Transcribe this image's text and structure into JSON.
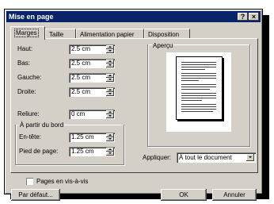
{
  "window": {
    "title": "Mise en page",
    "help_label": "?",
    "close_label": "×"
  },
  "tabs": [
    "Marges",
    "Taille",
    "Alimentation papier",
    "Disposition"
  ],
  "margins": {
    "top": {
      "label": "Haut:",
      "value": "2.5 cm"
    },
    "bottom": {
      "label": "Bas:",
      "value": "2.5 cm"
    },
    "left": {
      "label": "Gauche:",
      "value": "2.5 cm"
    },
    "right": {
      "label": "Droite:",
      "value": "2.5 cm"
    },
    "gutter": {
      "label": "Reliure:",
      "value": "0 cm"
    }
  },
  "from_edge": {
    "caption": "À partir du bord",
    "header": {
      "label": "En-tête:",
      "value": "1.25 cm"
    },
    "footer": {
      "label": "Pied de page:",
      "value": "1.25 cm"
    }
  },
  "preview": {
    "caption": "Aperçu"
  },
  "apply": {
    "label": "Appliquer:",
    "value": "À tout le document"
  },
  "mirror": {
    "label": "Pages en vis-à-vis",
    "checked": false
  },
  "buttons": {
    "default": "Par défaut...",
    "ok": "OK",
    "cancel": "Annuler"
  }
}
